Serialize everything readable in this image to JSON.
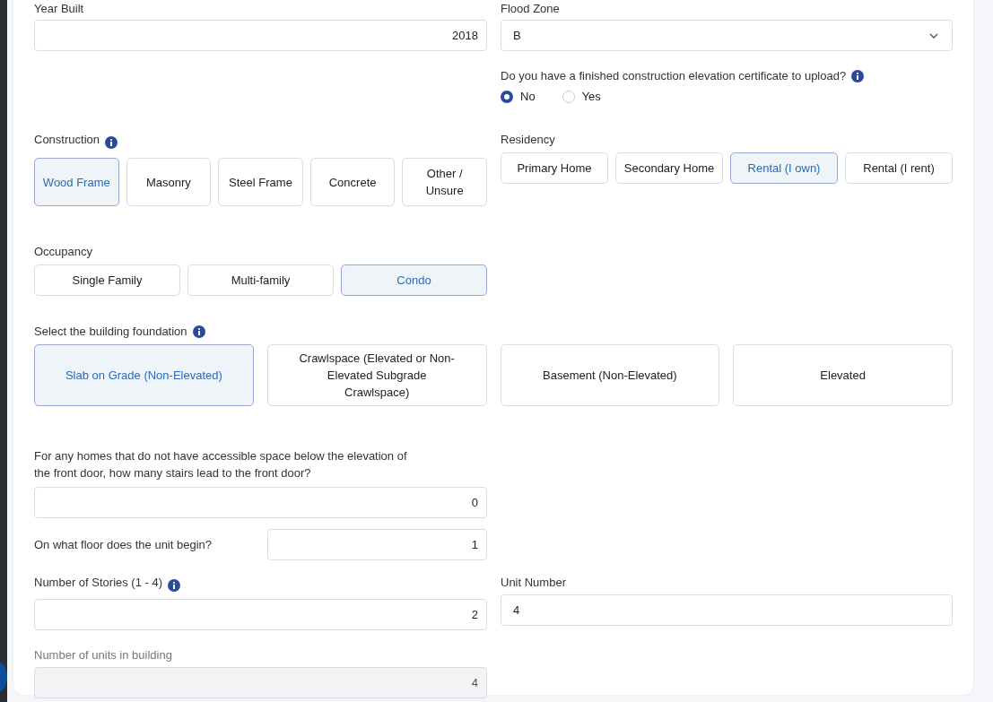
{
  "year_built": {
    "label": "Year Built",
    "value": "2018"
  },
  "flood_zone": {
    "label": "Flood Zone",
    "value": "B"
  },
  "elevation_certificate": {
    "question": "Do you have a finished construction elevation certificate to upload?",
    "options": [
      {
        "label": "No",
        "selected": true
      },
      {
        "label": "Yes",
        "selected": false
      }
    ]
  },
  "construction": {
    "label": "Construction",
    "options": [
      {
        "label": "Wood Frame",
        "selected": true
      },
      {
        "label": "Masonry",
        "selected": false
      },
      {
        "label": "Steel Frame",
        "selected": false
      },
      {
        "label": "Concrete",
        "selected": false
      },
      {
        "label": "Other / Unsure",
        "selected": false
      }
    ]
  },
  "residency": {
    "label": "Residency",
    "options": [
      {
        "label": "Primary Home",
        "selected": false
      },
      {
        "label": "Secondary Home",
        "selected": false
      },
      {
        "label": "Rental (I own)",
        "selected": true
      },
      {
        "label": "Rental (I rent)",
        "selected": false
      }
    ]
  },
  "occupancy": {
    "label": "Occupancy",
    "options": [
      {
        "label": "Single Family",
        "selected": false
      },
      {
        "label": "Multi-family",
        "selected": false
      },
      {
        "label": "Condo",
        "selected": true
      }
    ]
  },
  "foundation": {
    "label": "Select the building foundation",
    "options": [
      {
        "label": "Slab on Grade (Non-Elevated)",
        "selected": true
      },
      {
        "label": "Crawlspace (Elevated or Non-Elevated Subgrade Crawlspace)",
        "selected": false
      },
      {
        "label": "Basement (Non-Elevated)",
        "selected": false
      },
      {
        "label": "Elevated",
        "selected": false
      }
    ]
  },
  "stairs": {
    "label": "For any homes that do not have accessible space below the elevation of the front door, how many stairs lead to the front door?",
    "value": "0"
  },
  "unit_floor": {
    "label": "On what floor does the unit begin?",
    "value": "1"
  },
  "stories": {
    "label": "Number of Stories (1 - 4)",
    "value": "2"
  },
  "unit_number": {
    "label": "Unit Number",
    "value": "4"
  },
  "units_in_building": {
    "label": "Number of units in building",
    "value": "4",
    "disabled": true
  }
}
